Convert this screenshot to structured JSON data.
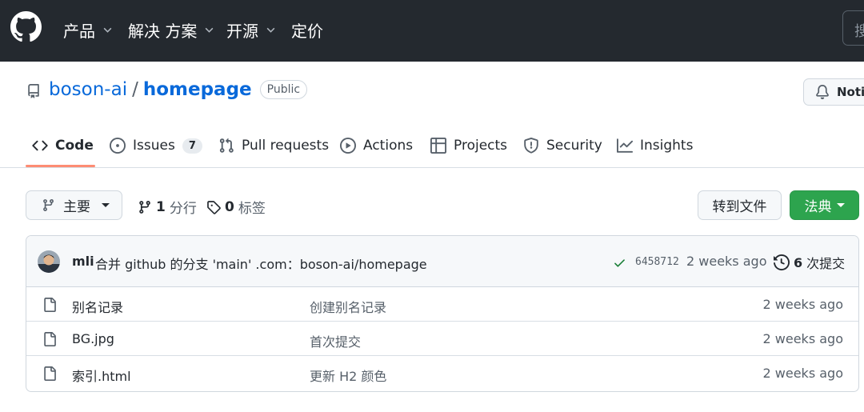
{
  "topnav": {
    "items": [
      {
        "label": "产品",
        "has_dropdown": true
      },
      {
        "label": "解决 方案",
        "has_dropdown": true
      },
      {
        "label": "开源",
        "has_dropdown": true
      },
      {
        "label": "定价",
        "has_dropdown": false
      }
    ],
    "search_label": "搜"
  },
  "repo": {
    "owner": "boson-ai",
    "separator": "/",
    "name": "homepage",
    "visibility": "Public",
    "notify_label": "Notif"
  },
  "tabs": [
    {
      "label": "Code",
      "icon": "code-icon",
      "active": true
    },
    {
      "label": "Issues",
      "icon": "issue-opened-icon",
      "count": "7"
    },
    {
      "label": "Pull requests",
      "icon": "git-pull-request-icon"
    },
    {
      "label": "Actions",
      "icon": "play-icon"
    },
    {
      "label": "Projects",
      "icon": "table-icon"
    },
    {
      "label": "Security",
      "icon": "shield-icon"
    },
    {
      "label": "Insights",
      "icon": "graph-icon"
    }
  ],
  "branch_bar": {
    "branch_label": "主要",
    "branches_count": "1",
    "branches_label": "分行",
    "tags_count": "0",
    "tags_label": "标签",
    "goto_file_label": "转到文件",
    "code_label": "法典"
  },
  "latest_commit": {
    "author": "mli",
    "message": "合并 github 的分支 'main' .com：boson-ai/homepage",
    "sha": "6458712",
    "time": "2 weeks ago",
    "commits_count": "6",
    "commits_label": "次提交",
    "status": "success"
  },
  "files": [
    {
      "name": "别名记录",
      "message": "创建别名记录",
      "time": "2 weeks ago"
    },
    {
      "name": "BG.jpg",
      "message": "首次提交",
      "time": "2 weeks ago"
    },
    {
      "name": "索引.html",
      "message": "更新 H2 颜色",
      "time": "2 weeks ago"
    }
  ],
  "colors": {
    "header_bg": "#24292f",
    "link": "#0969da",
    "code_button": "#2da44e",
    "tab_underline": "#fd8c73",
    "success_check": "#1a7f37"
  }
}
